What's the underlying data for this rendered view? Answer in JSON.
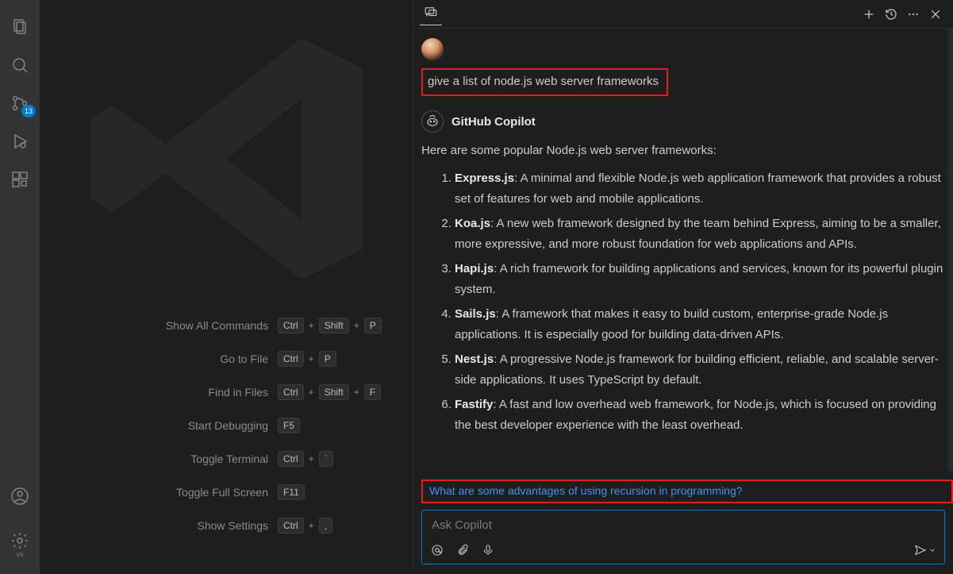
{
  "activity_bar": {
    "explorer_icon": "files-icon",
    "search_icon": "search-icon",
    "scm_icon": "source-control-icon",
    "scm_badge": "13",
    "run_icon": "run-debug-icon",
    "extensions_icon": "extensions-icon",
    "account_icon": "account-icon",
    "settings_icon": "gear-icon",
    "vs_label": "VS"
  },
  "welcome": {
    "shortcuts": [
      {
        "label": "Show All Commands",
        "keys": [
          "Ctrl",
          "Shift",
          "P"
        ]
      },
      {
        "label": "Go to File",
        "keys": [
          "Ctrl",
          "P"
        ]
      },
      {
        "label": "Find in Files",
        "keys": [
          "Ctrl",
          "Shift",
          "F"
        ]
      },
      {
        "label": "Start Debugging",
        "keys": [
          "F5"
        ]
      },
      {
        "label": "Toggle Terminal",
        "keys": [
          "Ctrl",
          "`"
        ]
      },
      {
        "label": "Toggle Full Screen",
        "keys": [
          "F11"
        ]
      },
      {
        "label": "Show Settings",
        "keys": [
          "Ctrl",
          ","
        ]
      }
    ]
  },
  "chat": {
    "user_prompt": "give a list of node.js web server frameworks",
    "ai_name": "GitHub Copilot",
    "ai_intro": "Here are some popular Node.js web server frameworks:",
    "frameworks": [
      {
        "name": "Express.js",
        "desc": ": A minimal and flexible Node.js web application framework that provides a robust set of features for web and mobile applications."
      },
      {
        "name": "Koa.js",
        "desc": ": A new web framework designed by the team behind Express, aiming to be a smaller, more expressive, and more robust foundation for web applications and APIs."
      },
      {
        "name": "Hapi.js",
        "desc": ": A rich framework for building applications and services, known for its powerful plugin system."
      },
      {
        "name": "Sails.js",
        "desc": ": A framework that makes it easy to build custom, enterprise-grade Node.js applications. It is especially good for building data-driven APIs."
      },
      {
        "name": "Nest.js",
        "desc": ": A progressive Node.js framework for building efficient, reliable, and scalable server-side applications. It uses TypeScript by default."
      },
      {
        "name": "Fastify",
        "desc": ": A fast and low overhead web framework, for Node.js, which is focused on providing the best developer experience with the least overhead."
      }
    ],
    "suggestion": "What are some advantages of using recursion in programming?",
    "input_placeholder": "Ask Copilot"
  }
}
